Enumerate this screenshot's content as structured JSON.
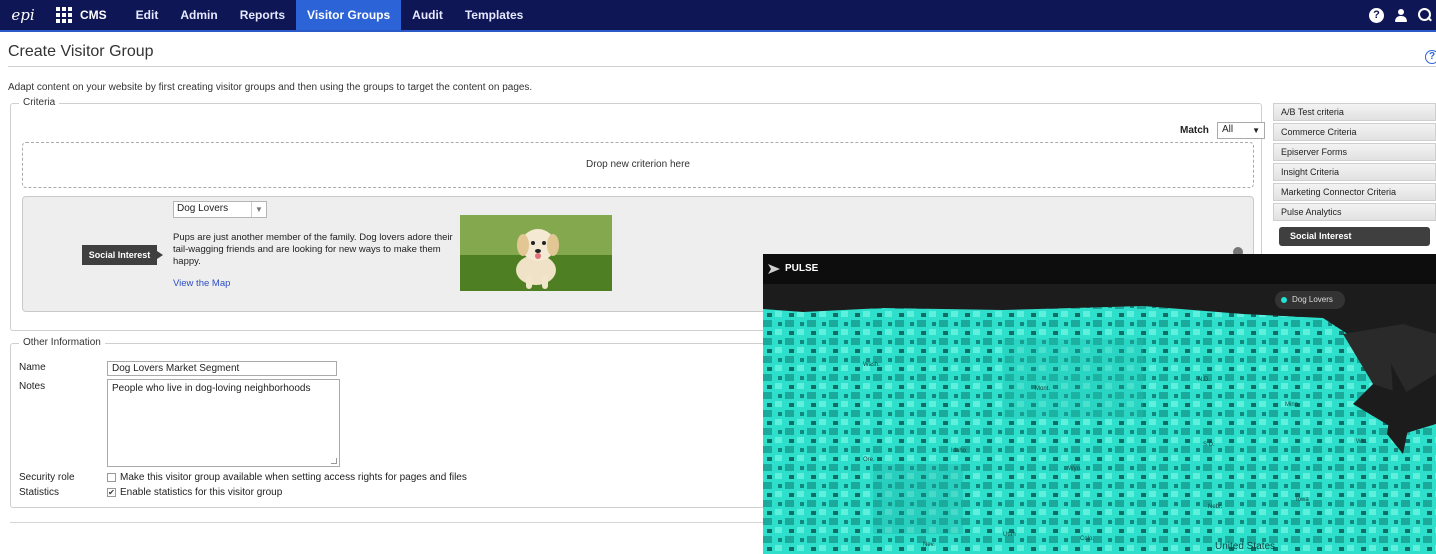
{
  "nav": {
    "logo": "epi",
    "product": "CMS",
    "items": [
      "Edit",
      "Admin",
      "Reports",
      "Visitor Groups",
      "Audit",
      "Templates"
    ],
    "active": "Visitor Groups",
    "help_glyph": "?"
  },
  "page": {
    "title": "Create Visitor Group",
    "intro": "Adapt content on your website by first creating visitor groups and then using the groups to target the content on pages.",
    "help_glyph": "?"
  },
  "criteria": {
    "legend": "Criteria",
    "match_label": "Match",
    "match_value": "All",
    "drop_zone": "Drop new criterion here",
    "criterion": {
      "tag": "Social Interest",
      "selected": "Dog Lovers",
      "description": "Pups are just another member of the family. Dog lovers adore their tail-wagging friends and are looking for new ways to make them happy.",
      "link": "View the Map"
    }
  },
  "other": {
    "legend": "Other Information",
    "name_label": "Name",
    "name_value": "Dog Lovers Market Segment",
    "notes_label": "Notes",
    "notes_value": "People who live in dog-loving neighborhoods",
    "security_label": "Security role",
    "security_text": "Make this visitor group available when setting access rights for pages and files",
    "security_checked": false,
    "stats_label": "Statistics",
    "stats_text": "Enable statistics for this visitor group",
    "stats_checked": true
  },
  "panel": {
    "items": [
      "A/B Test criteria",
      "Commerce Criteria",
      "Episerver Forms",
      "Insight Criteria",
      "Marketing Connector Criteria",
      "Pulse Analytics"
    ],
    "active": "Social Interest"
  },
  "pulse": {
    "title": "PULSE",
    "legend": "Dog Lovers",
    "accent": "#1fe3d4",
    "map_labels": [
      "Wash.",
      "Mont.",
      "N.D.",
      "Minn.",
      "Ore.",
      "Idaho",
      "Wyo.",
      "S.D.",
      "Wis.",
      "Nev.",
      "Utah",
      "Colo.",
      "Nebr.",
      "Iowa",
      "United States"
    ]
  }
}
